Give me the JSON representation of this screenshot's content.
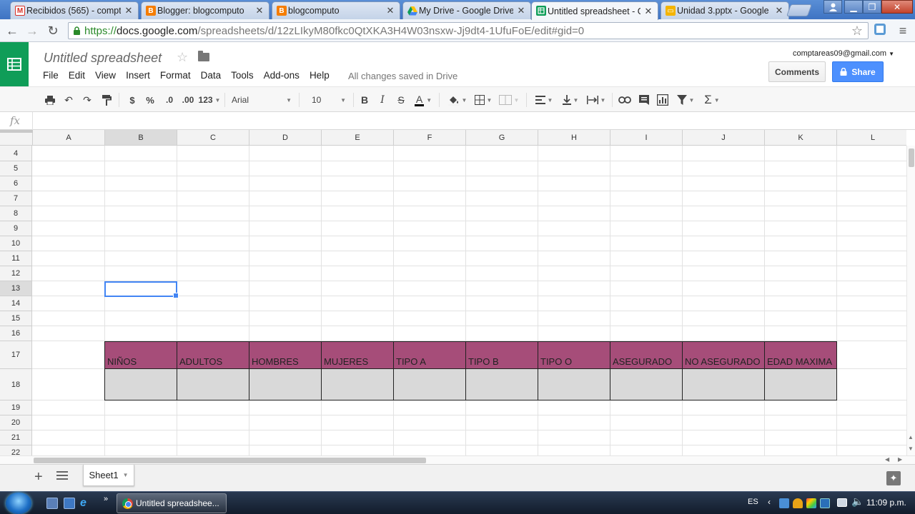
{
  "browser": {
    "tabs": [
      {
        "title": "Recibidos (565) - compt",
        "icon": "gmail-icon",
        "color": "#d93025"
      },
      {
        "title": "Blogger: blogcomputo",
        "icon": "blogger-icon",
        "color": "#f57d00"
      },
      {
        "title": "blogcomputo",
        "icon": "blogger-icon",
        "color": "#f57d00"
      },
      {
        "title": "My Drive - Google Drive",
        "icon": "drive-icon",
        "color": "#0f9d58"
      },
      {
        "title": "Untitled spreadsheet - G",
        "icon": "sheets-icon",
        "color": "#0f9d58",
        "active": true
      },
      {
        "title": "Unidad 3.pptx - Google",
        "icon": "slides-icon",
        "color": "#f4b400"
      }
    ],
    "url": {
      "scheme": "https://",
      "host": "docs.google.com",
      "path": "/spreadsheets/d/12zLIkyM80fkc0QtXKA3H4W03nsxw-Jj9dt4-1UfuFoE/edit#gid=0"
    }
  },
  "doc": {
    "title": "Untitled spreadsheet",
    "menu": [
      "File",
      "Edit",
      "View",
      "Insert",
      "Format",
      "Data",
      "Tools",
      "Add-ons",
      "Help"
    ],
    "save_status": "All changes saved in Drive",
    "account": "comptareas09@gmail.com",
    "comments_label": "Comments",
    "share_label": "Share"
  },
  "toolbar": {
    "currency": "$",
    "percent": "%",
    "dec_decrease": ".0",
    "dec_increase": ".00",
    "more_formats": "123",
    "font": "Arial",
    "font_size": "10",
    "bold": "B",
    "italic": "I",
    "strike": "S",
    "text_color": "A",
    "sum": "Σ"
  },
  "formula_bar": {
    "fx_label": "fx",
    "value": ""
  },
  "sheet": {
    "columns": [
      "A",
      "B",
      "C",
      "D",
      "E",
      "F",
      "G",
      "H",
      "I",
      "J",
      "K",
      "L"
    ],
    "rows": [
      "4",
      "5",
      "6",
      "7",
      "8",
      "9",
      "10",
      "11",
      "12",
      "13",
      "14",
      "15",
      "16",
      "17",
      "18",
      "19",
      "20",
      "21",
      "22"
    ],
    "selected_column": "B",
    "selected_row": "13",
    "header_row": [
      "NIÑOS",
      "ADULTOS",
      "HOMBRES",
      "MUJERES",
      "TIPO A",
      "TIPO B",
      "TIPO O",
      "ASEGURADO",
      "NO ASEGURADO",
      "EDAD MAXIMA"
    ],
    "header_fill": "#a64d79",
    "data_fill": "#d9d9d9",
    "tab_name": "Sheet1"
  },
  "taskbar": {
    "app_label": "Untitled spreadshee...",
    "language": "ES",
    "clock": "11:09 p.m."
  }
}
